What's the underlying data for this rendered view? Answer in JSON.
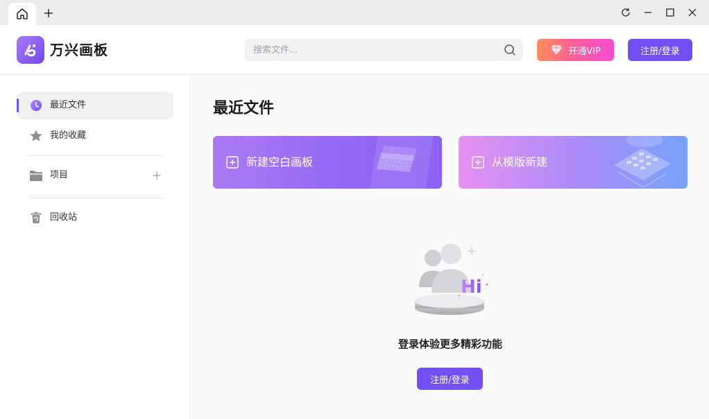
{
  "tabs": {
    "home_icon": "home-icon",
    "new_tab_icon": "plus-icon"
  },
  "window": {
    "refresh_icon": "refresh-icon",
    "minimize_icon": "minimize-icon",
    "maximize_icon": "maximize-icon",
    "close_icon": "close-icon"
  },
  "header": {
    "app_name": "万兴画板",
    "search": {
      "placeholder": "搜索文件..."
    },
    "vip_label": "开通VIP",
    "login_label": "注册/登录"
  },
  "sidebar": {
    "items": [
      {
        "label": "最近文件",
        "icon": "clock-icon",
        "active": true
      },
      {
        "label": "我的收藏",
        "icon": "star-icon",
        "active": false
      },
      {
        "label": "项目",
        "icon": "folder-icon",
        "active": false
      },
      {
        "label": "回收站",
        "icon": "trash-icon",
        "active": false
      }
    ]
  },
  "main": {
    "title": "最近文件",
    "cards": [
      {
        "label": "新建空白画板"
      },
      {
        "label": "从模版新建"
      }
    ],
    "empty_message": "登录体验更多精彩功能",
    "empty_button": "注册/登录",
    "illustration_text": "Hi"
  },
  "colors": {
    "accent": "#7350f5",
    "vip_gradient_start": "#ff8b5a",
    "vip_gradient_end": "#f24fd1"
  }
}
